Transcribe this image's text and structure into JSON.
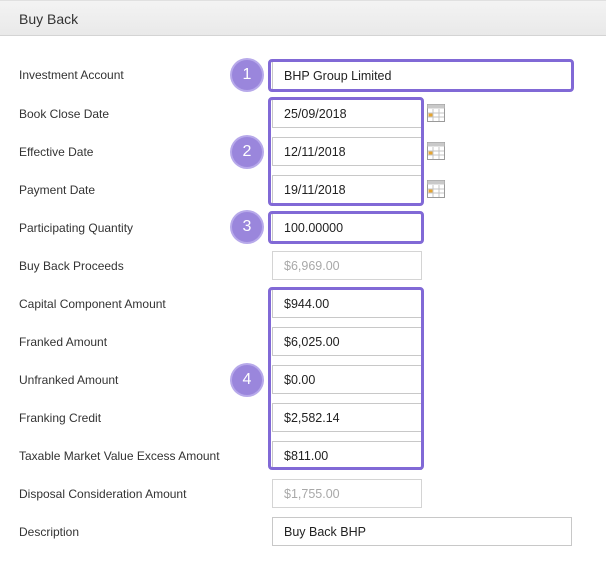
{
  "header": {
    "title": "Buy Back"
  },
  "fields": [
    {
      "label": "Investment Account",
      "value": "BHP Group Limited"
    },
    {
      "label": "Book Close Date",
      "value": "25/09/2018"
    },
    {
      "label": "Effective Date",
      "value": "12/11/2018"
    },
    {
      "label": "Payment Date",
      "value": "19/11/2018"
    },
    {
      "label": "Participating Quantity",
      "value": "100.00000"
    },
    {
      "label": "Buy Back Proceeds",
      "value": "$6,969.00"
    },
    {
      "label": "Capital Component Amount",
      "value": "$944.00"
    },
    {
      "label": "Franked Amount",
      "value": "$6,025.00"
    },
    {
      "label": "Unfranked Amount",
      "value": "$0.00"
    },
    {
      "label": "Franking Credit",
      "value": "$2,582.14"
    },
    {
      "label": "Taxable Market Value Excess Amount",
      "value": "$811.00"
    },
    {
      "label": "Disposal Consideration Amount",
      "value": "$1,755.00"
    },
    {
      "label": "Description",
      "value": "Buy Back BHP"
    }
  ],
  "badges": [
    "1",
    "2",
    "3",
    "4"
  ],
  "icons": {
    "calendar": "calendar-icon"
  },
  "colors": {
    "highlight": "#8169d6",
    "badge": "#9a86dc"
  }
}
